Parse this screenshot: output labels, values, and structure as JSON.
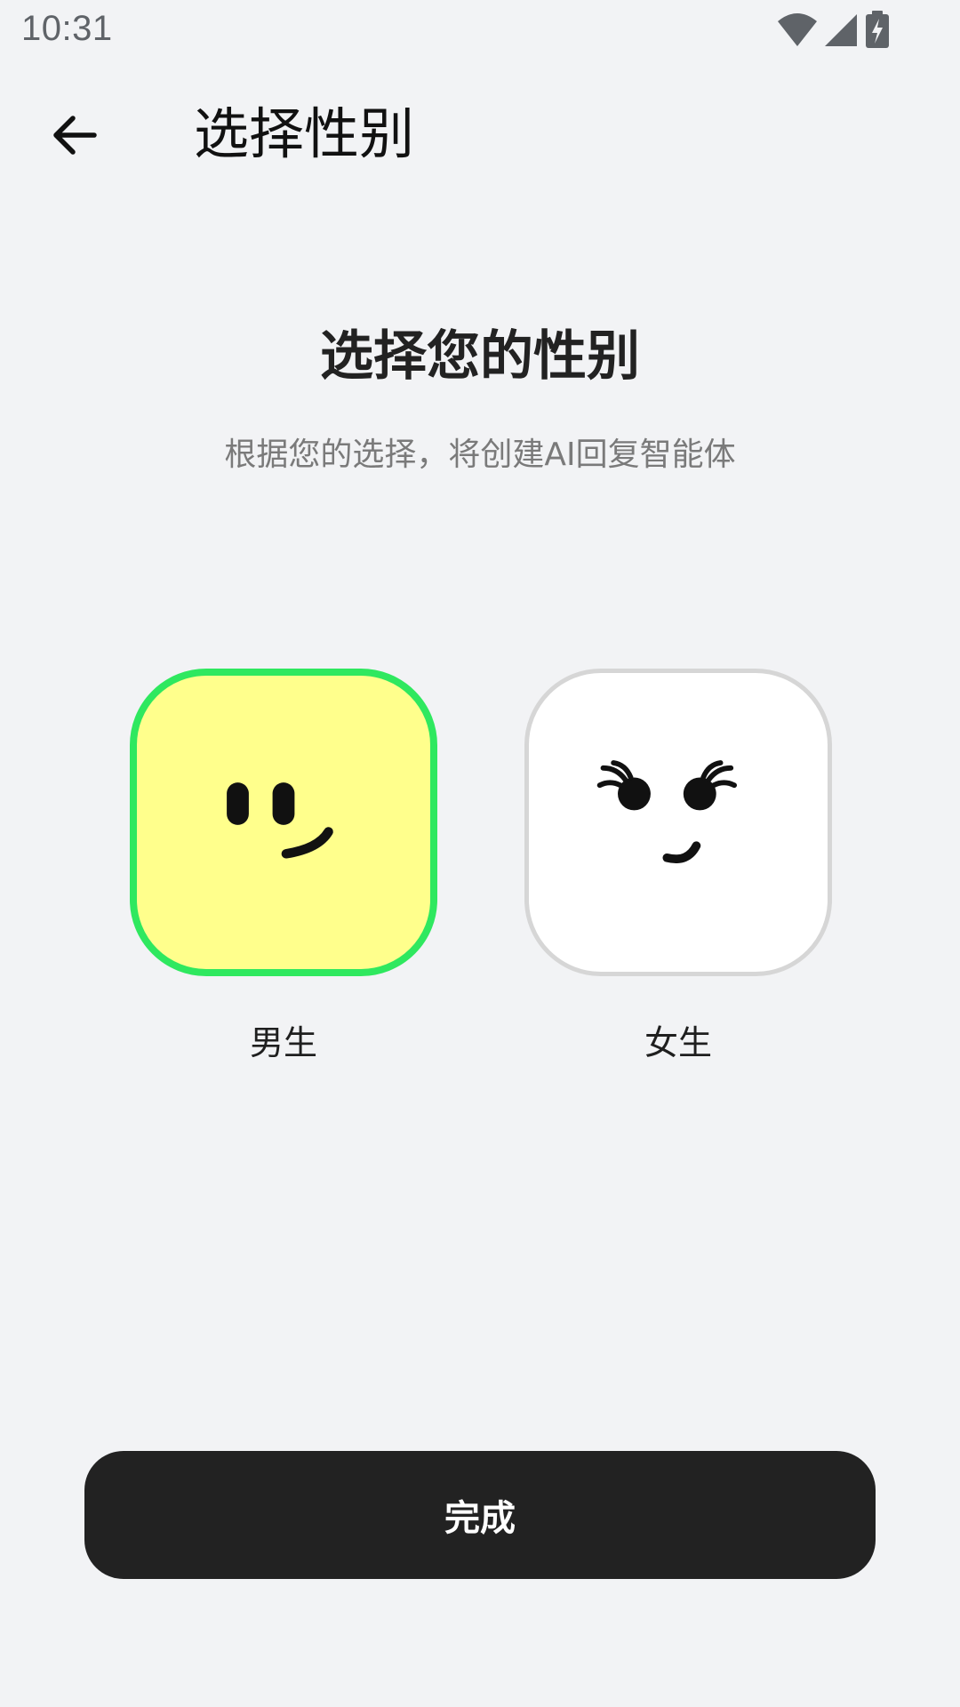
{
  "status_bar": {
    "time": "10:31",
    "icons": [
      "wifi-icon",
      "signal-icon",
      "battery-charging-icon"
    ]
  },
  "app_bar": {
    "back_icon": "arrow-left-icon",
    "title": "选择性别"
  },
  "main": {
    "heading": "选择您的性别",
    "subheading": "根据您的选择，将创建AI回复智能体",
    "options": [
      {
        "label": "男生",
        "selected": true,
        "card_color": "#ffff8c",
        "border_color": "#2fe85f",
        "icon": "male-smiley-face-icon"
      },
      {
        "label": "女生",
        "selected": false,
        "card_color": "#ffffff",
        "border_color": "#d6d6d6",
        "icon": "female-smiley-face-icon"
      }
    ]
  },
  "footer": {
    "done_label": "完成",
    "button_color": "#222222"
  }
}
